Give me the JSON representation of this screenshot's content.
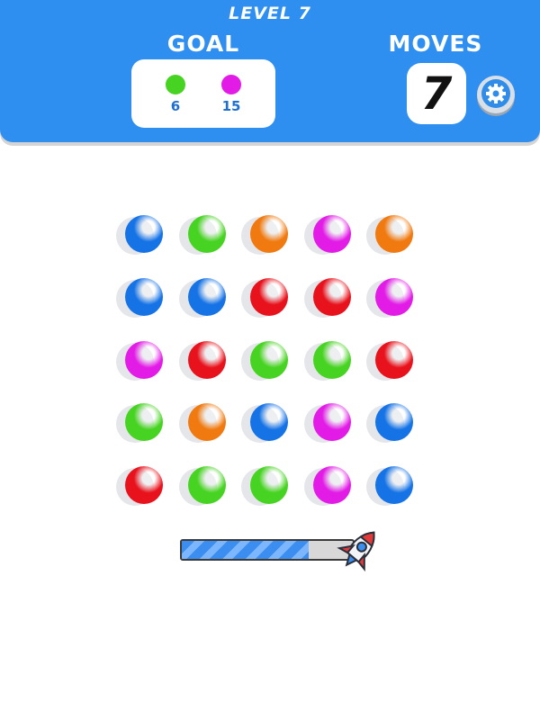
{
  "header": {
    "level_label": "LEVEL 7",
    "goal_label": "GOAL",
    "moves_label": "MOVES",
    "moves_value": "7"
  },
  "goals": [
    {
      "color_name": "green",
      "color": "#47d321",
      "count": "6"
    },
    {
      "color_name": "magenta",
      "color": "#e21be6",
      "count": "15"
    }
  ],
  "colors": {
    "blue": "#1673e6",
    "green": "#47d321",
    "orange": "#f07a10",
    "magenta": "#e21be6",
    "red": "#e8121c",
    "header_blue": "#2e8ff0"
  },
  "board": [
    [
      "blue",
      "green",
      "orange",
      "magenta",
      "orange"
    ],
    [
      "blue",
      "blue",
      "red",
      "red",
      "magenta"
    ],
    [
      "magenta",
      "red",
      "green",
      "green",
      "red"
    ],
    [
      "green",
      "orange",
      "blue",
      "magenta",
      "blue"
    ],
    [
      "red",
      "green",
      "green",
      "magenta",
      "blue"
    ]
  ],
  "progress": {
    "fraction": 0.74
  },
  "icons": {
    "settings": "gear-icon",
    "progress_end": "rocket-icon"
  }
}
